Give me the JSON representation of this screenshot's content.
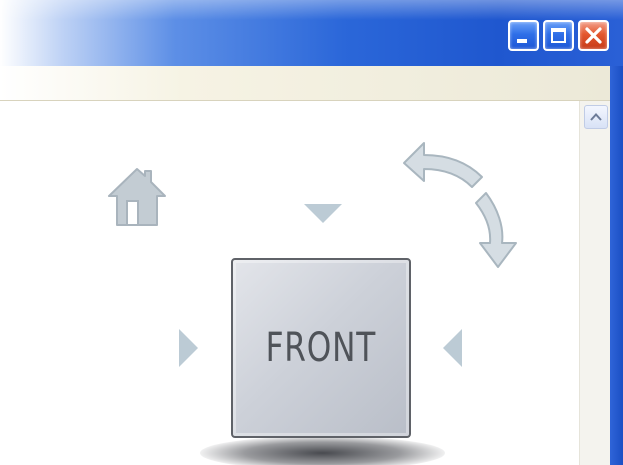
{
  "window": {
    "title_buttons": {
      "minimize_icon": "minimize-icon",
      "maximize_icon": "maximize-icon",
      "close_icon": "close-icon"
    }
  },
  "viewcube": {
    "face_label": "FRONT",
    "icons": {
      "home": "home-icon",
      "rotate": "rotate-arrow-icon",
      "arrow_top": "triangle-down-icon",
      "arrow_left": "triangle-right-icon",
      "arrow_right": "triangle-left-icon"
    }
  },
  "colors": {
    "titlebar_blue": "#2b67d9",
    "close_red": "#e4572e",
    "cube_gray": "#cdd1d9",
    "icon_gray": "#b9c4cc"
  }
}
